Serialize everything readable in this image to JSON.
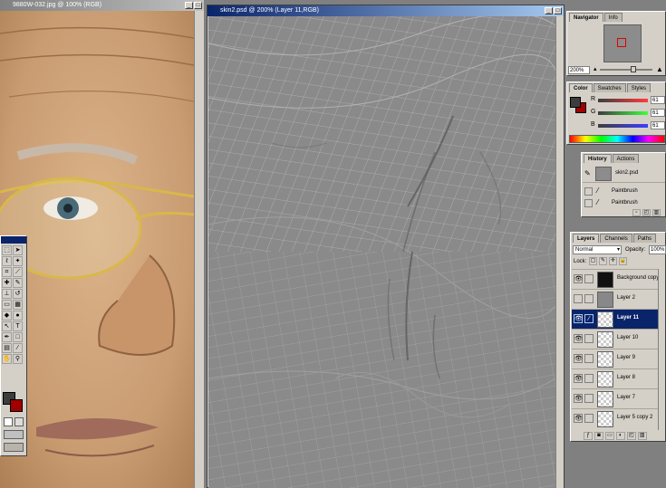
{
  "left_doc": {
    "title": "9880W-032.jpg @ 100% (RGB)"
  },
  "main_doc": {
    "title": "skin2.psd @ 200% (Layer 11,RGB)"
  },
  "navigator": {
    "tabs": [
      "Navigator",
      "Info"
    ],
    "zoom": "200%"
  },
  "color": {
    "tabs": [
      "Color",
      "Swatches",
      "Styles"
    ],
    "channels": [
      {
        "label": "R",
        "value": "61"
      },
      {
        "label": "G",
        "value": "61"
      },
      {
        "label": "B",
        "value": "61"
      }
    ],
    "foreground": "#3d3d3d",
    "background": "#a00000"
  },
  "history": {
    "tabs": [
      "History",
      "Actions"
    ],
    "snapshot": "skin2.psd",
    "steps": [
      "Paintbrush",
      "Paintbrush"
    ]
  },
  "layers": {
    "tabs": [
      "Layers",
      "Channels",
      "Paths"
    ],
    "blend_mode": "Normal",
    "opacity_label": "Opacity:",
    "opacity": "100%",
    "lock_label": "Lock:",
    "items": [
      "Background copy",
      "Layer 2",
      "Layer 11",
      "Layer 10",
      "Layer 9",
      "Layer 8",
      "Layer 7",
      "Layer 5 copy 2"
    ],
    "selected_index": 2
  }
}
